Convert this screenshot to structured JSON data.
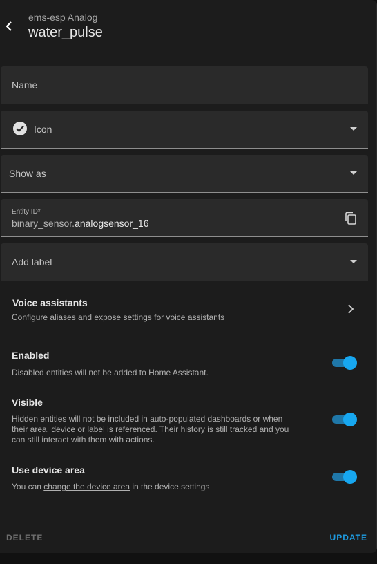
{
  "header": {
    "subtitle": "ems-esp Analog",
    "title": "water_pulse"
  },
  "fields": {
    "name_label": "Name",
    "icon_label": "Icon",
    "show_as_label": "Show as",
    "entity_id_label": "Entity ID*",
    "entity_id_prefix": "binary_sensor.",
    "entity_id_value": "analogsensor_16",
    "add_label": "Add label"
  },
  "voice": {
    "title": "Voice assistants",
    "desc": "Configure aliases and expose settings for voice assistants"
  },
  "enabled": {
    "title": "Enabled",
    "desc": "Disabled entities will not be added to Home Assistant.",
    "on": true
  },
  "visible": {
    "title": "Visible",
    "desc_1": "Hidden entities will not be included in auto-populated dashboards or when",
    "desc_2": "their area, device or label is referenced. Their history is still tracked and you",
    "desc_3": "can still interact with them with actions.",
    "on": true
  },
  "device_area": {
    "title": "Use device area",
    "desc_before": "You can ",
    "link": "change the device area",
    "desc_after": " in the device settings",
    "on": true
  },
  "footer": {
    "delete": "DELETE",
    "update": "UPDATE"
  },
  "colors": {
    "accent": "#17a7f0",
    "background": "#1c1c1c",
    "field": "#2a2a2a"
  },
  "icons": {
    "back": "chevron-left-icon",
    "icon_field": "check-circle-icon",
    "copy": "copy-icon",
    "voice": "chevron-right-icon",
    "dropdown": "caret-down-icon"
  }
}
